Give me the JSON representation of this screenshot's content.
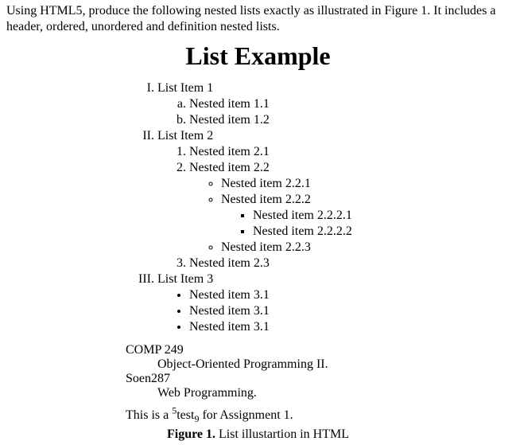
{
  "intro": "Using HTML5, produce the following nested lists exactly as illustrated in Figure 1. It includes a header, ordered, unordered and definition nested lists.",
  "title": "List Example",
  "ol": {
    "i1": {
      "label": "List Item 1",
      "a": "Nested item 1.1",
      "b": "Nested item 1.2"
    },
    "i2": {
      "label": "List Item 2",
      "n1": "Nested item 2.1",
      "n2": {
        "label": "Nested item 2.2",
        "c1": "Nested item 2.2.1",
        "c2": {
          "label": "Nested item 2.2.2",
          "s1": "Nested item 2.2.2.1",
          "s2": "Nested item 2.2.2.2"
        },
        "c3": "Nested item 2.2.3"
      },
      "n3": "Nested item 2.3"
    },
    "i3": {
      "label": "List Item 3",
      "d1": "Nested item 3.1",
      "d2": "Nested item 3.1",
      "d3": "Nested item 3.1"
    }
  },
  "dl": {
    "t1": "COMP 249",
    "d1": "Object-Oriented Programming II.",
    "t2": "Soen287",
    "d2": "Web Programming."
  },
  "testline": {
    "pre": "This is a ",
    "sup": "5",
    "mid": "test",
    "sub": "9",
    "post": " for Assignment 1."
  },
  "caption": {
    "bold": "Figure 1.",
    "rest": " List illustartion in HTML"
  }
}
